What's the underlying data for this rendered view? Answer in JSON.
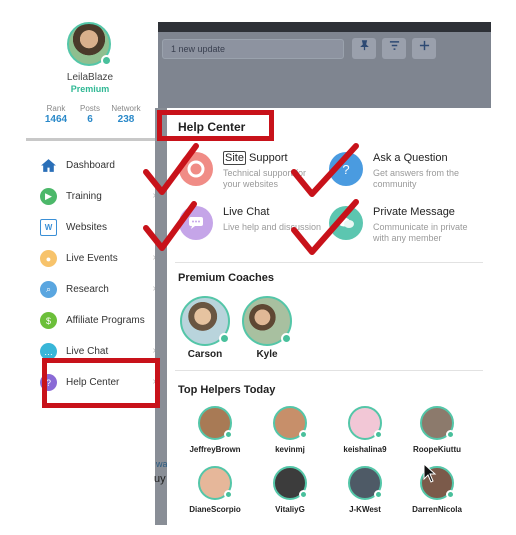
{
  "topbar": {
    "update_text": "1 new update",
    "icons": [
      "pin-icon",
      "filter-icon",
      "plus-icon"
    ]
  },
  "profile": {
    "username": "LeilaBlaze",
    "membership": "Premium",
    "stats": [
      {
        "label": "Rank",
        "value": "1464"
      },
      {
        "label": "Posts",
        "value": "6"
      },
      {
        "label": "Network",
        "value": "238"
      }
    ]
  },
  "sidebar": {
    "items": [
      {
        "label": "Dashboard",
        "icon": "home-icon",
        "color": "#2a6fb8"
      },
      {
        "label": "Training",
        "icon": "play-icon",
        "color": "#4cb86a"
      },
      {
        "label": "Websites",
        "icon": "websites-icon",
        "color": "#3a8fd6"
      },
      {
        "label": "Live Events",
        "icon": "live-events-icon",
        "color": "#f0a030"
      },
      {
        "label": "Research",
        "icon": "research-icon",
        "color": "#3a8fd6"
      },
      {
        "label": "Affiliate Programs",
        "icon": "affiliate-icon",
        "color": "#6cbf3a"
      },
      {
        "label": "Live Chat",
        "icon": "chat-icon",
        "color": "#38b6d8"
      },
      {
        "label": "Help Center",
        "icon": "help-icon",
        "color": "#8a6ad6"
      }
    ]
  },
  "edge_fragments": {
    "text1": "wa",
    "text2": "uy"
  },
  "help_center": {
    "title": "Help Center",
    "options": [
      {
        "title_prefix": "Site",
        "title_rest": " Support",
        "desc": "Technical support for your websites",
        "icon": "lifebuoy-icon",
        "color": "#f08c86"
      },
      {
        "title_prefix": "",
        "title_rest": "Ask a Question",
        "desc": "Get answers from the community",
        "icon": "question-icon",
        "color": "#4a9be0"
      },
      {
        "title_prefix": "",
        "title_rest": "Live Chat",
        "desc": "Live help and discussion",
        "icon": "chat-bubble-icon",
        "color": "#c5a5e8"
      },
      {
        "title_prefix": "",
        "title_rest": "Private Message",
        "desc": "Communicate in private with any member",
        "icon": "message-icon",
        "color": "#5cc6b0"
      }
    ],
    "premium_coaches_title": "Premium Coaches",
    "coaches": [
      "Carson",
      "Kyle"
    ],
    "top_helpers_title": "Top Helpers Today",
    "helpers": [
      {
        "name": "JeffreyBrown",
        "color": "#a87a55"
      },
      {
        "name": "kevinmj",
        "color": "#c78f6a"
      },
      {
        "name": "keishalina9",
        "color": "#f2c7d6"
      },
      {
        "name": "RoopeKiuttu",
        "color": "#8c7a6c"
      },
      {
        "name": "DianeScorpio",
        "color": "#e6b79a"
      },
      {
        "name": "VitaliyG",
        "color": "#3c3c3c"
      },
      {
        "name": "J-KWest",
        "color": "#4e5a66"
      },
      {
        "name": "DarrenNicola",
        "color": "#7b5a4a"
      }
    ]
  }
}
